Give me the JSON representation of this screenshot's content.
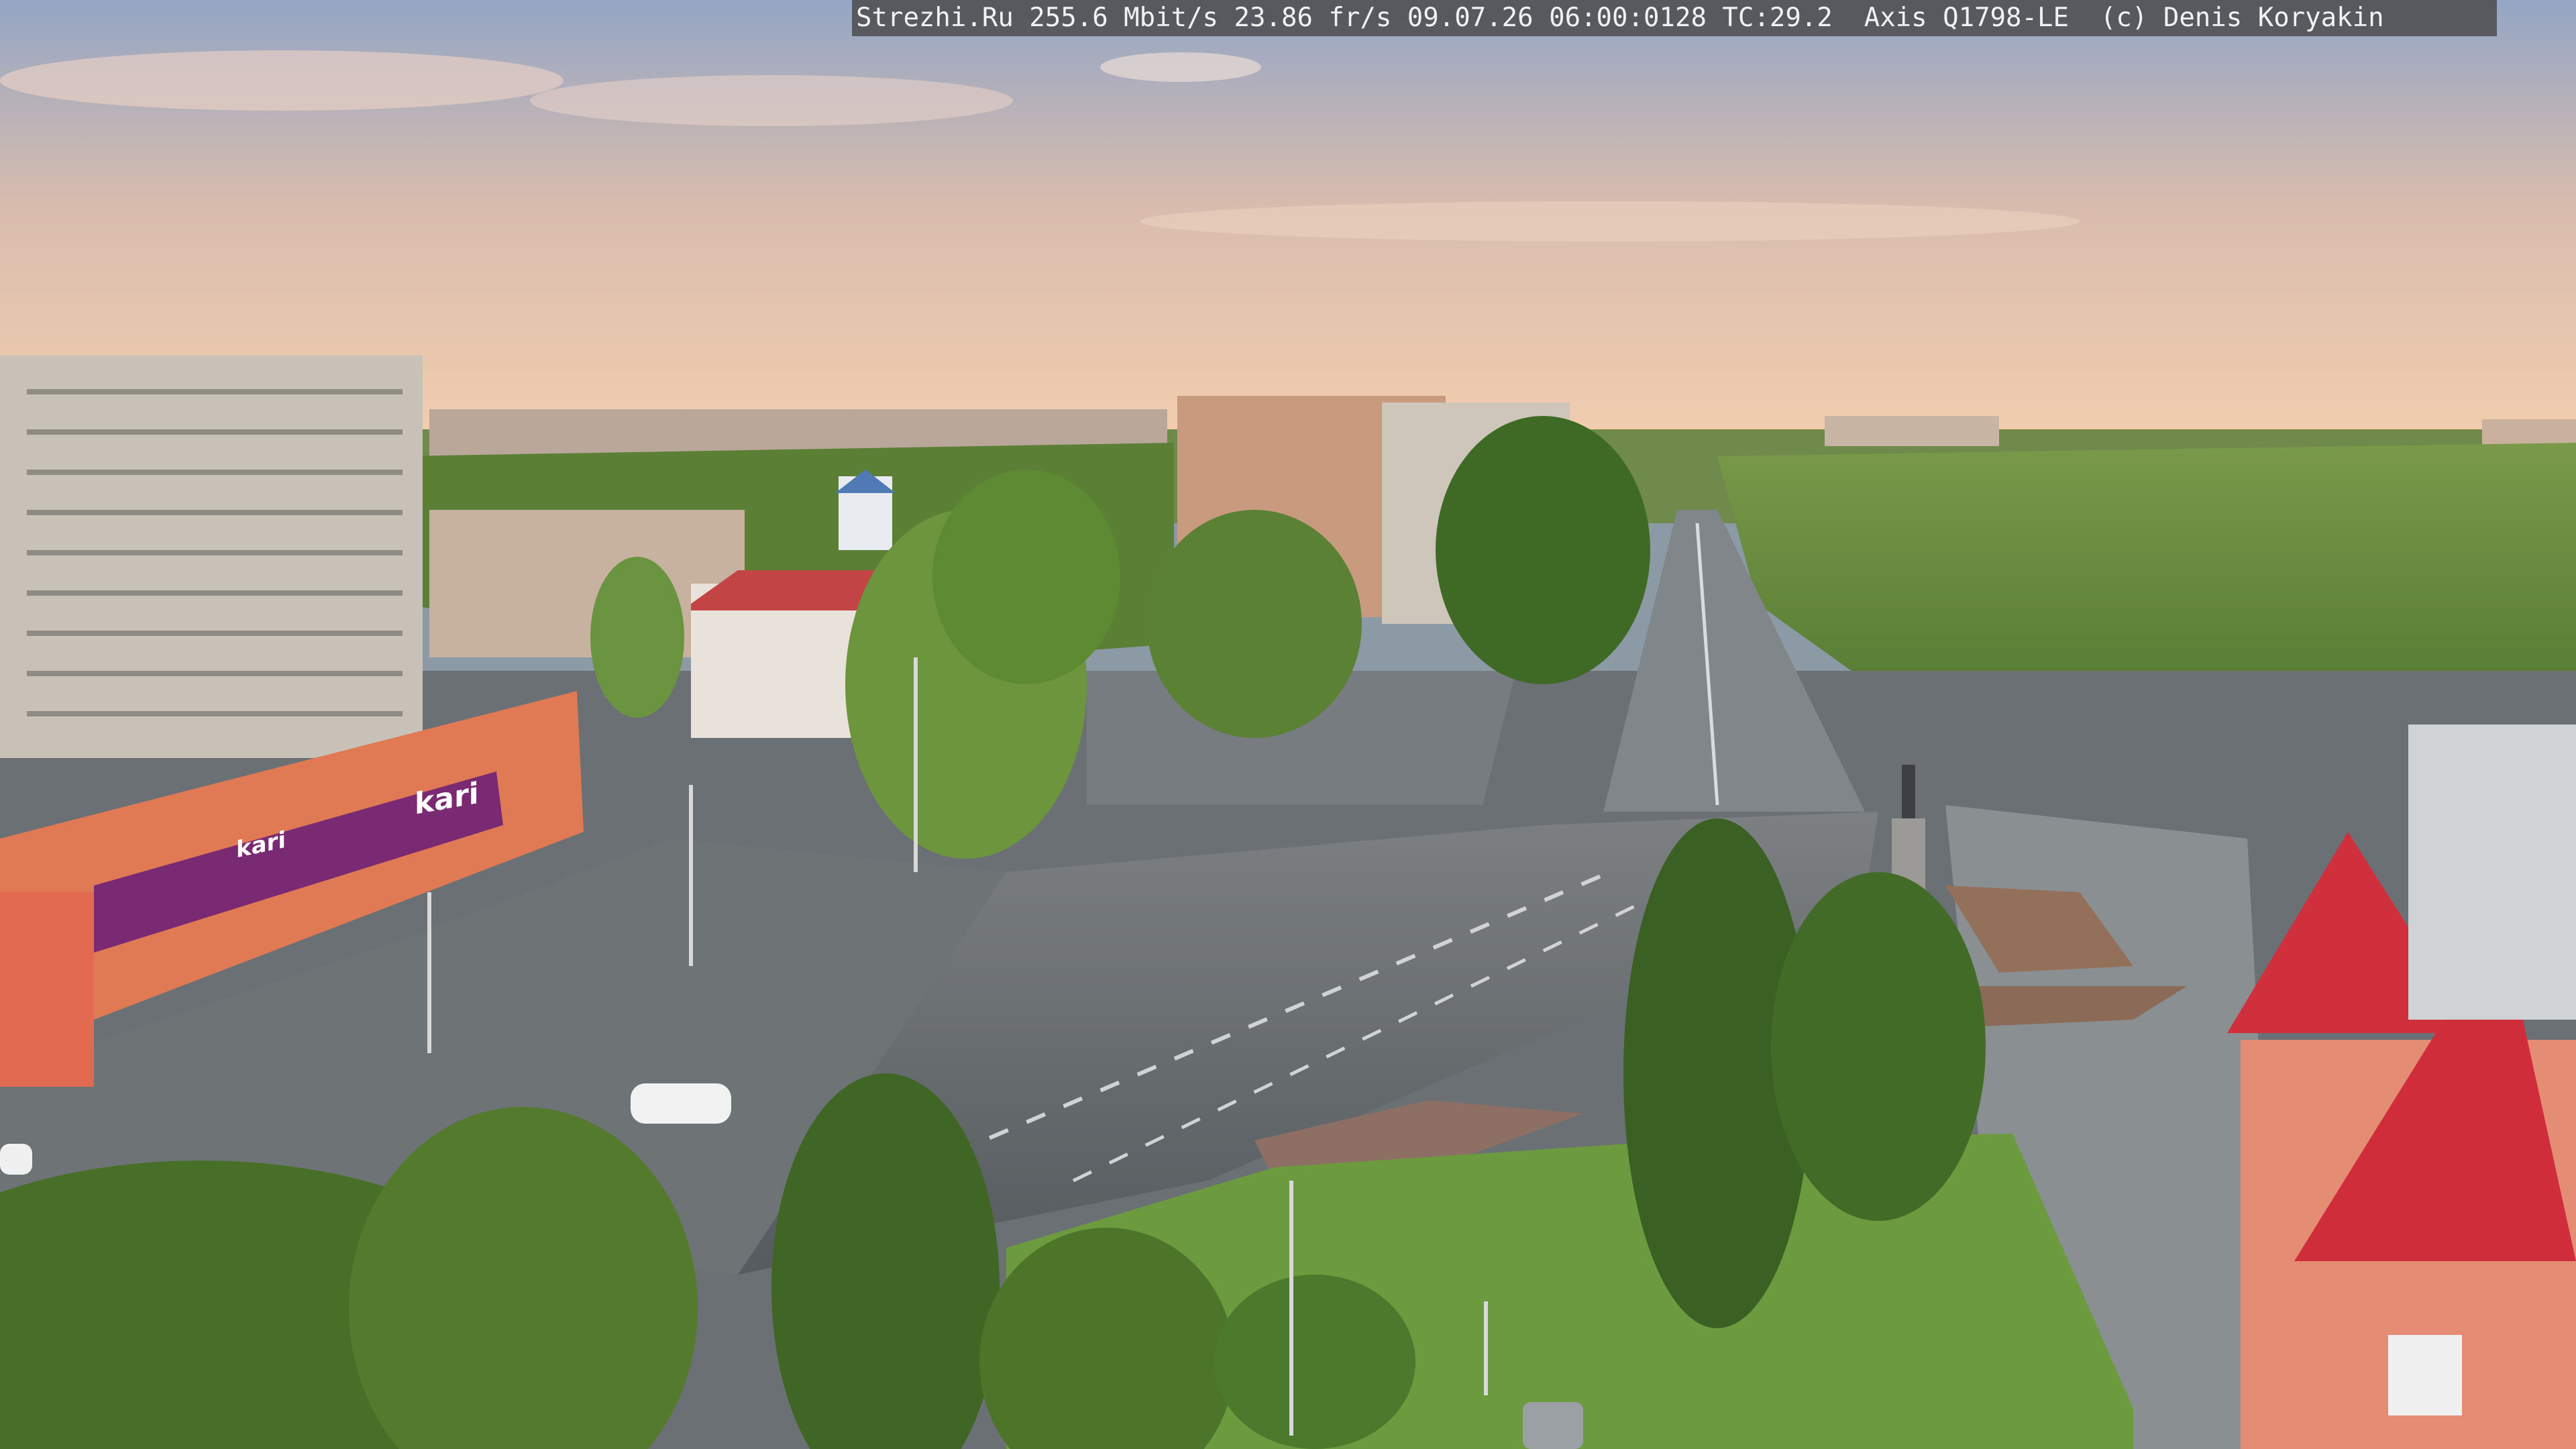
{
  "overlay": {
    "text": "Strezhi.Ru 255.6 Mbit/s 23.86 fr/s 09.07.26 06:00:0128 TC:29.2  Axis Q1798-LE  (c) Denis Koryakin"
  },
  "storefront": {
    "brand_label": "kari",
    "brand_label_small": "kari"
  },
  "colors": {
    "sky_top": "#9aaac4",
    "sky_horizon": "#f2c9a8",
    "tree_green": "#4f7a2f",
    "road_gray": "#5f6568",
    "facade_orange": "#e2764e",
    "roof_red": "#cf2f3a",
    "sign_purple": "#7a2a72"
  }
}
